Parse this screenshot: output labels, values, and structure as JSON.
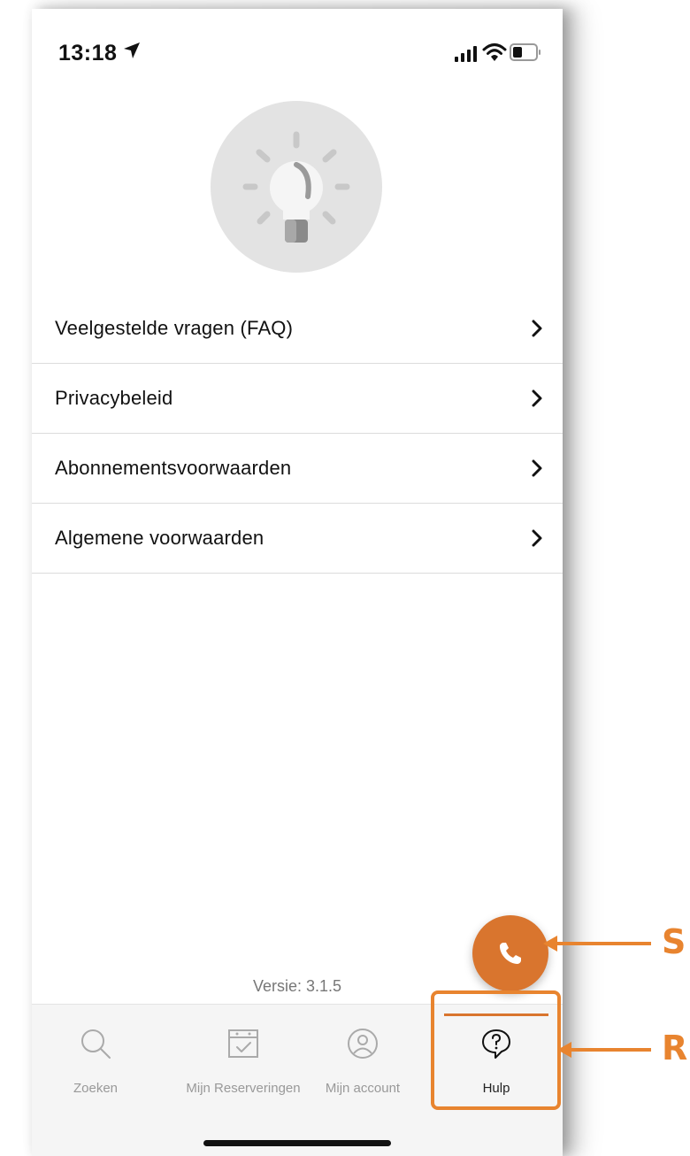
{
  "status_bar": {
    "time": "13:18",
    "icons": [
      "location-arrow-icon",
      "signal-icon",
      "wifi-icon",
      "battery-icon"
    ]
  },
  "hero": {
    "icon": "lightbulb-icon"
  },
  "menu": {
    "items": [
      {
        "label": "Veelgestelde vragen (FAQ)"
      },
      {
        "label": "Privacybeleid"
      },
      {
        "label": "Abonnementsvoorwaarden"
      },
      {
        "label": "Algemene voorwaarden"
      }
    ]
  },
  "version": "Versie: 3.1.5",
  "fab": {
    "icon": "phone-icon",
    "color": "#d9752e"
  },
  "tab_bar": {
    "tabs": [
      {
        "label": "Zoeken",
        "icon": "search-icon"
      },
      {
        "label": "Mijn Reserveringen",
        "icon": "calendar-check-icon"
      },
      {
        "label": "Mijn account",
        "icon": "user-circle-icon"
      },
      {
        "label": "Hulp",
        "icon": "help-bubble-icon",
        "active": true
      }
    ]
  },
  "annotations": {
    "fab_letter": "S",
    "tab_letter": "R",
    "color": "#e8842f"
  },
  "colors": {
    "accent": "#d9752e",
    "annotation": "#e8842f"
  }
}
